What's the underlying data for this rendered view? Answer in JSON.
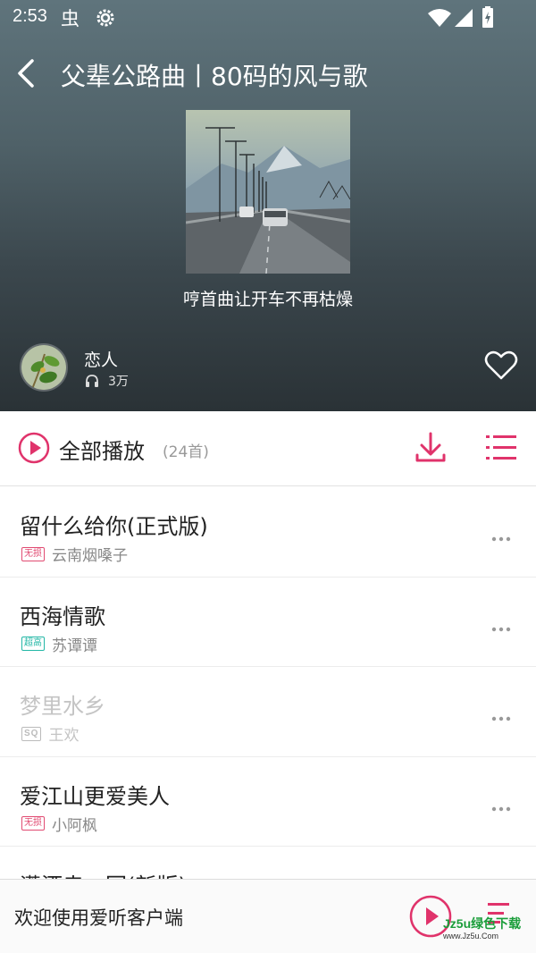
{
  "status_bar": {
    "time": "2:53"
  },
  "header": {
    "title": "父辈公路曲丨80码的风与歌"
  },
  "playlist": {
    "description": "哼首曲让开车不再枯燥"
  },
  "creator": {
    "name": "恋人",
    "listen_count": "3万"
  },
  "play_all": {
    "label": "全部播放",
    "count": "(24首)"
  },
  "songs": [
    {
      "title": "留什么给你(正式版)",
      "badge": "无损",
      "artist": "云南烟嗓子"
    },
    {
      "title": "西海情歌",
      "badge": "超高",
      "artist": "苏谭谭"
    },
    {
      "title": "梦里水乡",
      "badge": "SQ",
      "artist": "王欢"
    },
    {
      "title": "爱江山更爱美人",
      "badge": "无损",
      "artist": "小阿枫"
    },
    {
      "title": "潇洒走一回(新版)",
      "badge": "",
      "artist": ""
    }
  ],
  "mini_player": {
    "text": "欢迎使用爱听客户端"
  },
  "watermark": {
    "brand": "Jz5u绿色下载",
    "site": "www.Jz5u.Com"
  },
  "colors": {
    "accent": "#e0336b",
    "hd_badge": "#23b7a6"
  }
}
